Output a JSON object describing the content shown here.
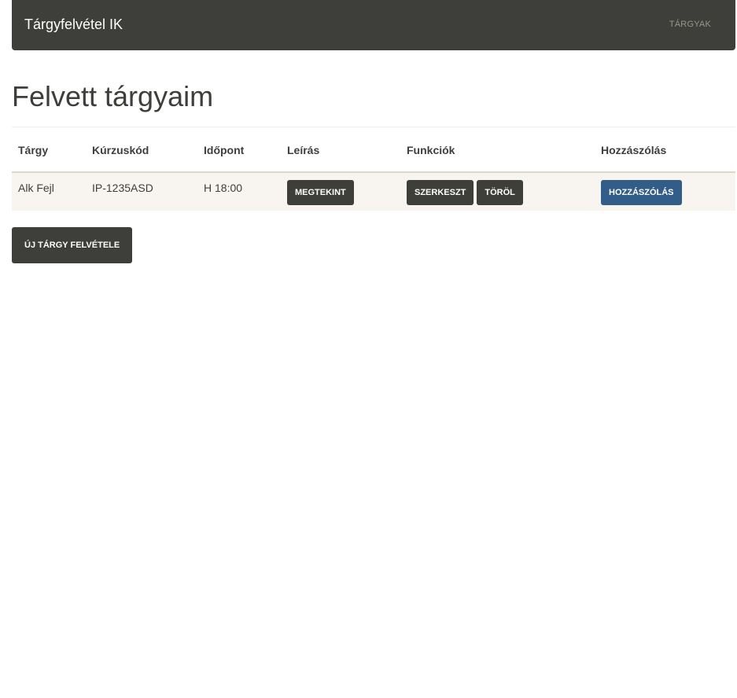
{
  "navbar": {
    "brand": "Tárgyfelvétel IK",
    "links": [
      {
        "label": "TÁRGYAK"
      }
    ]
  },
  "main": {
    "title": "Felvett tárgyaim",
    "table": {
      "columns": [
        "Tárgy",
        "Kúrzuskód",
        "Időpont",
        "Leírás",
        "Funkciók",
        "Hozzászólás"
      ],
      "rows": [
        {
          "subject": "Alk Fejl",
          "code": "IP-1235ASD",
          "time": "H 18:00",
          "view_label": "MEGTEKINT",
          "edit_label": "SZERKESZT",
          "delete_label": "TÖRÖL",
          "comment_label": "HOZZÁSZÓLÁS"
        }
      ]
    },
    "new_button_label": "ÚJ TÁRGY FELVÉTELE"
  },
  "colors": {
    "navbar_bg": "#3e3f3a",
    "button_dark": "#3e3f3a",
    "button_primary": "#325d88",
    "row_bg": "#f8f5f0"
  }
}
